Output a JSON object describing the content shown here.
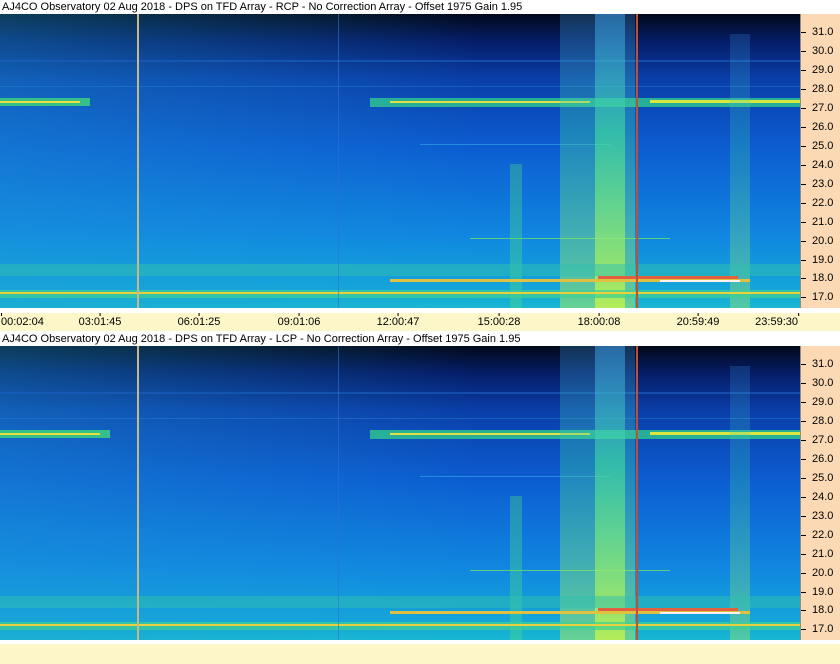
{
  "panels": [
    {
      "title": "AJ4CO Observatory 02 Aug 2018 - DPS on TFD Array   - RCP  -  No Correction Array  -  Offset 1975  Gain 1.95",
      "y_ticks": [
        "31.0",
        "30.0",
        "29.0",
        "28.0",
        "27.0",
        "26.0",
        "25.0",
        "24.0",
        "23.0",
        "22.0",
        "21.0",
        "20.0",
        "19.0",
        "18.0",
        "17.0"
      ],
      "x_ticks": [
        "00:02:04",
        "03:01:45",
        "06:01:25",
        "09:01:06",
        "12:00:47",
        "15:00:28",
        "18:00:08",
        "20:59:49",
        "23:59:30"
      ]
    },
    {
      "title": "AJ4CO Observatory 02 Aug 2018 - DPS on TFD Array   - LCP  -  No Correction Array  -  Offset 1975  Gain 1.95",
      "y_ticks": [
        "31.0",
        "30.0",
        "29.0",
        "28.0",
        "27.0",
        "26.0",
        "25.0",
        "24.0",
        "23.0",
        "22.0",
        "21.0",
        "20.0",
        "19.0",
        "18.0",
        "17.0"
      ],
      "x_ticks": []
    }
  ],
  "colors": {
    "axis_bg": "#fbd9b5",
    "time_bar_bg": "#fdf6c8",
    "spectrogram_low": "#041a5c",
    "spectrogram_mid": "#0f78e6",
    "spectrogram_high": "#f0e020",
    "marker_line_beige": "#c7b88a",
    "marker_line_red": "#c05030"
  }
}
